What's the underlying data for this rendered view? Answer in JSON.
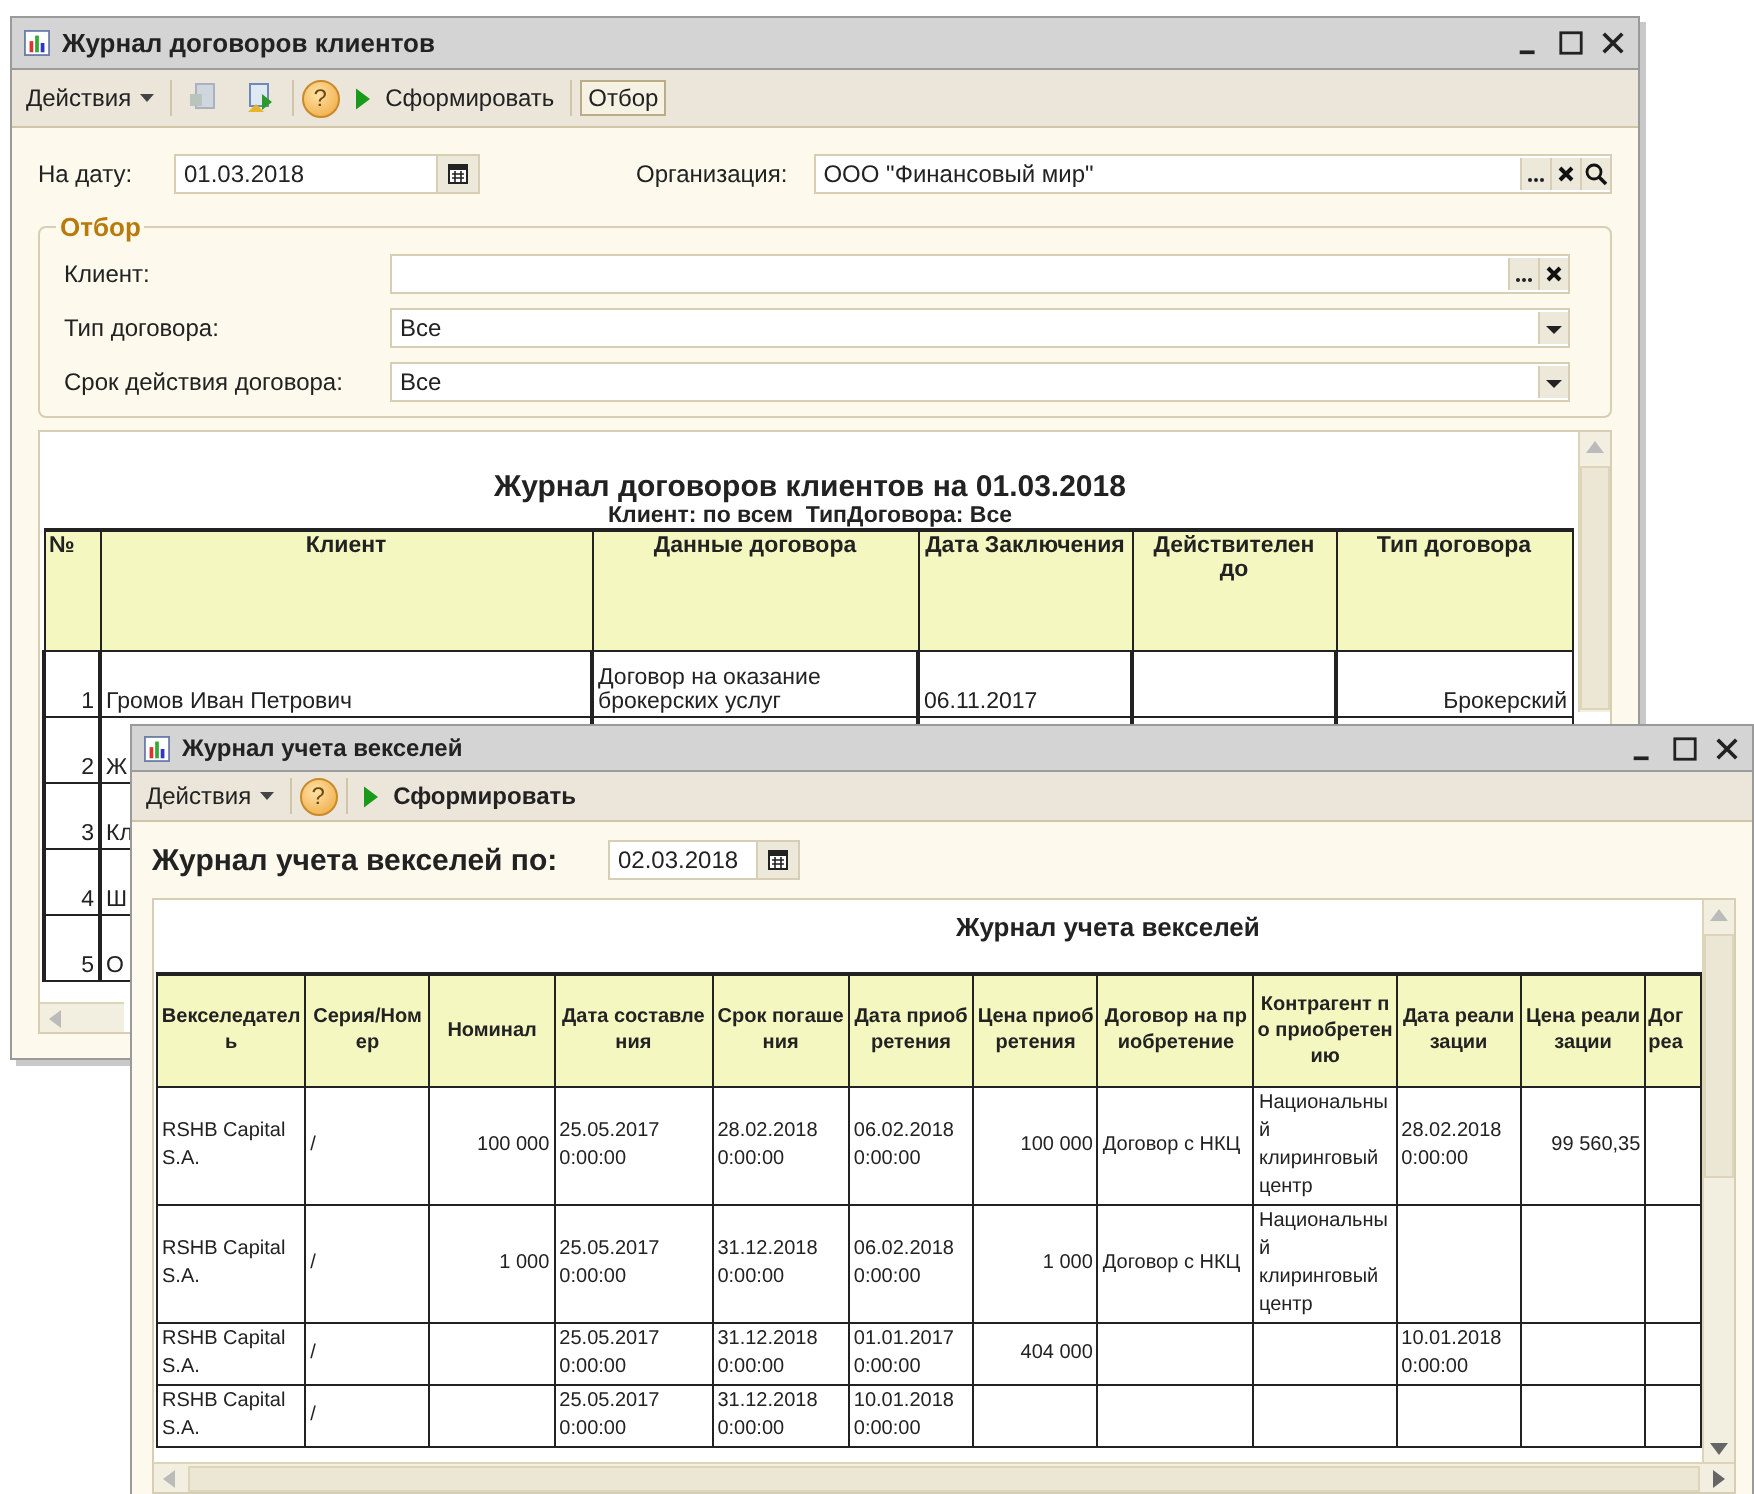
{
  "contracts_window": {
    "title": "Журнал договоров клиентов",
    "toolbar": {
      "actions": "Действия",
      "help": "?",
      "generate": "Сформировать",
      "filter": {
        "label": "Отбор",
        "selected": true
      }
    },
    "date": {
      "label": "На дату:",
      "value": "01.03.2018"
    },
    "organization": {
      "label": "Организация:",
      "value": "ООО \"Финансовый мир\""
    },
    "filter_group": {
      "title": "Отбор",
      "fields": [
        {
          "label": "Клиент:",
          "kind": "choice"
        },
        {
          "label": "Тип договора:",
          "value": "Все",
          "kind": "select"
        },
        {
          "label": "Срок действия договора:",
          "value": "Все",
          "kind": "select"
        }
      ]
    },
    "report": {
      "title": "Журнал договоров клиентов на 01.03.2018",
      "subtitle": "Клиент: по всем  ТипДоговора: Все",
      "columns": [
        "№",
        "Клиент",
        "Данные договора",
        "Дата Заключения",
        "Действителен до",
        "Тип договора"
      ],
      "rows": [
        [
          "1",
          "Громов Иван Петрович",
          "Договор на оказание брокерских услуг",
          "06.11.2017",
          null,
          "Брокерский"
        ],
        [
          "2",
          "Ж"
        ],
        [
          "3",
          "Кл"
        ],
        [
          "4",
          "Ш"
        ],
        [
          "5",
          "О"
        ]
      ]
    }
  },
  "bills_window": {
    "title": "Журнал учета векселей",
    "toolbar": {
      "actions": "Действия",
      "help": "?",
      "generate": "Сформировать"
    },
    "period": {
      "label": "Журнал учета векселей по:",
      "value": "02.03.2018"
    },
    "report": {
      "title": "Журнал учета векселей",
      "columns": [
        "Векселедатель",
        "Серия/Номер",
        "Номинал",
        "Дата составления",
        "Срок погашения",
        "Дата приобретения",
        "Цена приобретения",
        "Договор на приобретение",
        "Контрагент по приобретению",
        "Дата реализации",
        "Цена реализации",
        "Дог реа"
      ],
      "rows": [
        [
          "RSHB Capital S.A.",
          "/",
          "100 000",
          "25.05.2017 0:00:00",
          "28.02.2018 0:00:00",
          "06.02.2018 0:00:00",
          "100 000",
          "Договор с НКЦ",
          "Национальный клиринговый центр",
          "28.02.2018 0:00:00",
          "99 560,35",
          null
        ],
        [
          "RSHB Capital S.A.",
          "/",
          "1 000",
          "25.05.2017 0:00:00",
          "31.12.2018 0:00:00",
          "06.02.2018 0:00:00",
          "1 000",
          "Договор с НКЦ",
          "Национальный клиринговый центр",
          null,
          null,
          null
        ],
        [
          "RSHB Capital S.A.",
          "/",
          null,
          "25.05.2017 0:00:00",
          "31.12.2018 0:00:00",
          "01.01.2017 0:00:00",
          "404 000",
          null,
          null,
          "10.01.2018 0:00:00",
          null,
          null
        ],
        [
          "RSHB Capital S.A.",
          "/",
          null,
          "25.05.2017 0:00:00",
          "31.12.2018 0:00:00",
          "10.01.2018 0:00:00",
          null,
          null,
          null,
          null,
          null,
          null
        ]
      ]
    }
  }
}
